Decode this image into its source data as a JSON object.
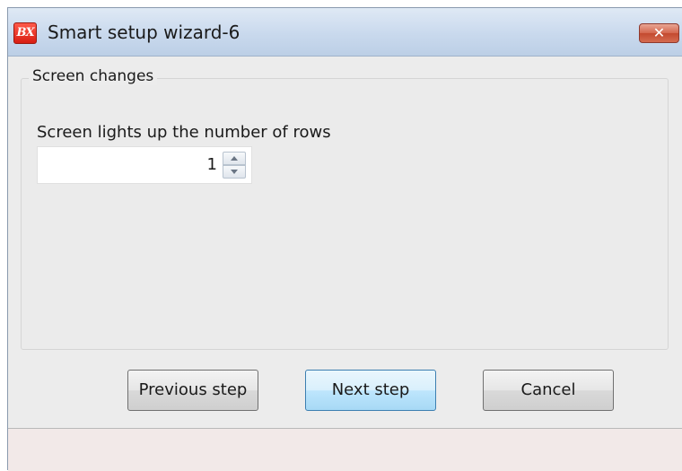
{
  "window": {
    "title": "Smart setup wizard-6",
    "app_icon_text": "BX",
    "app_icon_name": "bx-logo-icon",
    "close_glyph": "✕"
  },
  "group": {
    "label": "Screen changes"
  },
  "field": {
    "label": "Screen lights up the number of rows",
    "value": "1"
  },
  "buttons": {
    "previous": "Previous step",
    "next": "Next step",
    "cancel": "Cancel"
  },
  "colors": {
    "title_bar": "#c9d9ed",
    "close_button": "#d4664d",
    "app_icon": "#d81d12",
    "default_button": "#bee6fd",
    "dialog_bg": "#ececec",
    "status_bar": "#f2e9e8"
  }
}
